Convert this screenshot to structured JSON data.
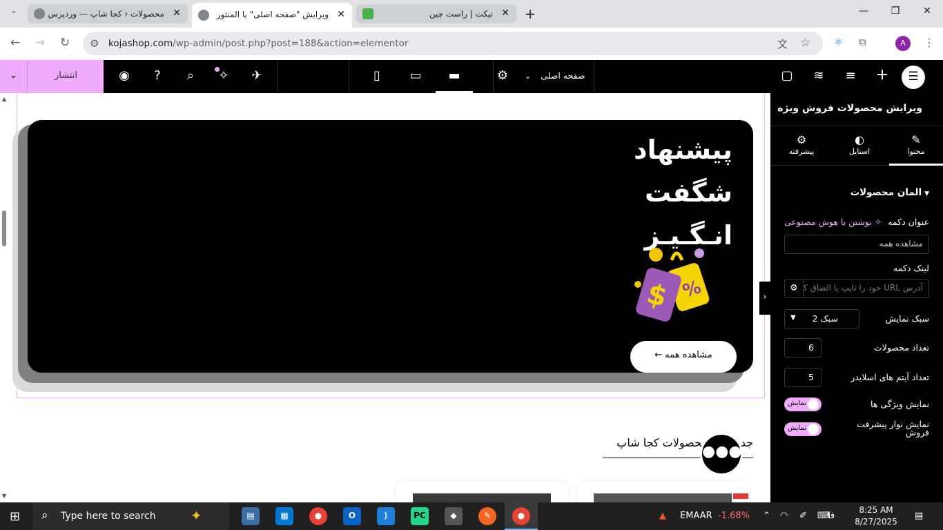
{
  "browser": {
    "tabs": [
      {
        "title": "محصولات ‹ کجا شاپ — وردپرس",
        "active": false
      },
      {
        "title": "ویرایش \"صفحه اصلی\" با المنتور",
        "active": true
      },
      {
        "title": "تیکت | راست چین",
        "active": false
      }
    ],
    "url_host": "kojashop.com",
    "url_path": "/wp-admin/post.php?post=188&action=elementor",
    "profile_initial": "A"
  },
  "elementor_bar": {
    "publish_label": "انتشار",
    "page_name": "صفحه اصلی"
  },
  "canvas": {
    "banner_title_lines": [
      "پیشنهاد",
      "شگفت",
      "انـگـیـز"
    ],
    "view_all_button": "مشاهده همه ←",
    "products_heading": "جدیدترین محصولات کجا شاپ"
  },
  "panel": {
    "header": "ویرایش محصولات فروش ویژه",
    "tabs": [
      {
        "label": "محتوا",
        "icon": "pencil-icon"
      },
      {
        "label": "استایل",
        "icon": "contrast-icon"
      },
      {
        "label": "پیشرفته",
        "icon": "gear-icon"
      }
    ],
    "section_title": "المان محصولات",
    "button_title_label": "عنوان دکمه",
    "ai_write_label": "نوشتن با هوش مصنوعی",
    "button_title_value": "مشاهده همه",
    "button_link_label": "لینک دکمه",
    "button_link_placeholder": "آدرس URL خود را تایپ یا الصاق ک",
    "display_style_label": "سبک نمایش",
    "display_style_value": "سبک 2",
    "product_count_label": "تعداد محصولات",
    "product_count_value": "6",
    "slider_items_label": "تعداد آیتم های اسلایدر",
    "slider_items_value": "5",
    "show_features_label": "نمایش ویژگی ها",
    "show_features_toggle": "نمایش",
    "show_progress_label_1": "نمایش نوار پیشرفت",
    "show_progress_label_2": "فروش",
    "show_progress_toggle": "نمایش"
  },
  "taskbar": {
    "search_placeholder": "Type here to search",
    "stock_name": "EMAAR",
    "stock_change": "-1.68%",
    "lang": "فا",
    "time": "8:25 AM",
    "date": "8/27/2025"
  },
  "colors": {
    "accent": "#f0abfc",
    "dark": "#000000"
  }
}
